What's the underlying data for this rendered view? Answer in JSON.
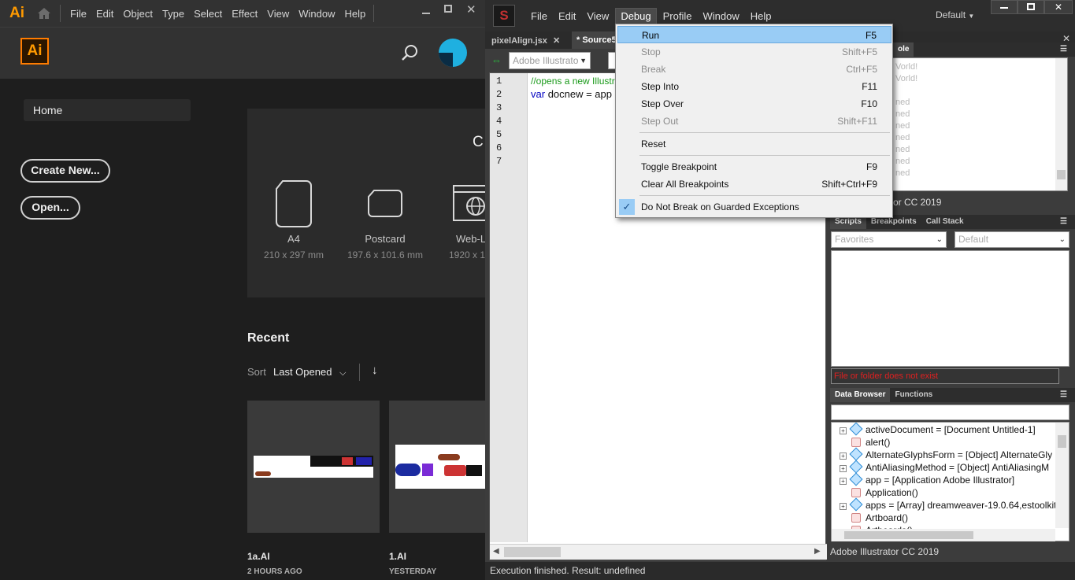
{
  "illustrator": {
    "logo_small": "Ai",
    "menu": [
      "File",
      "Edit",
      "Object",
      "Type",
      "Select",
      "Effect",
      "View",
      "Window",
      "Help"
    ],
    "logo": "Ai",
    "home": "Home",
    "create_new": "Create New...",
    "open": "Open...",
    "presets_heading_partial": "C",
    "presets": [
      {
        "name": "A4",
        "dims": "210 x 297 mm"
      },
      {
        "name": "Postcard",
        "dims": "197.6 x 101.6 mm"
      },
      {
        "name": "Web-L",
        "dims": "1920 x 1("
      }
    ],
    "recent": "Recent",
    "sort_label": "Sort",
    "sort_value": "Last Opened",
    "files": [
      {
        "name": "1a.AI",
        "time": "2 HOURS AGO"
      },
      {
        "name": "1.AI",
        "time": "YESTERDAY"
      }
    ]
  },
  "estk": {
    "menu": [
      "File",
      "Edit",
      "View",
      "Debug",
      "Profile",
      "Window",
      "Help"
    ],
    "workspace": "Default",
    "tabs": [
      "pixelAlign.jsx",
      "* Source5"
    ],
    "target_app": "Adobe Illustrato",
    "line_numbers": [
      "1",
      "2",
      "3",
      "4",
      "5",
      "6",
      "7"
    ],
    "code": [
      "//opens a new Illustra",
      "var docnew = app"
    ],
    "console_lines": [
      "Vorld!",
      "Vorld!",
      "",
      "ned",
      "ned",
      "ned",
      "ned",
      "ned",
      "ned",
      "ned"
    ],
    "console_tab_partial": "ole",
    "console_footer": "or CC 2019",
    "scripts_tabs": [
      "Scripts",
      "Breakpoints",
      "Call Stack"
    ],
    "favorites": "Favorites",
    "default_select": "Default",
    "file_error": "File or folder does not exist",
    "data_tabs": [
      "Data Browser",
      "Functions"
    ],
    "data_items": [
      {
        "kind": "obj",
        "text": "activeDocument = [Document Untitled-1]",
        "expand": true
      },
      {
        "kind": "fn",
        "text": "alert()",
        "expand": false
      },
      {
        "kind": "obj",
        "text": "AlternateGlyphsForm = [Object] AlternateGly",
        "expand": true
      },
      {
        "kind": "obj",
        "text": "AntiAliasingMethod = [Object] AntiAliasingM",
        "expand": true
      },
      {
        "kind": "obj",
        "text": "app = [Application Adobe Illustrator]",
        "expand": true
      },
      {
        "kind": "fn",
        "text": "Application()",
        "expand": false
      },
      {
        "kind": "obj",
        "text": "apps = [Array] dreamweaver-19.0.64,estoolkit",
        "expand": true
      },
      {
        "kind": "fn",
        "text": "Artboard()",
        "expand": false
      },
      {
        "kind": "fn",
        "text": "Artboards()",
        "expand": false
      }
    ],
    "data_footer": "Adobe Illustrator CC 2019",
    "status": "Execution finished. Result: undefined",
    "debug_menu": [
      {
        "label": "Run",
        "shortcut": "F5",
        "state": "highlight"
      },
      {
        "label": "Stop",
        "shortcut": "Shift+F5",
        "state": "disabled"
      },
      {
        "label": "Break",
        "shortcut": "Ctrl+F5",
        "state": "disabled"
      },
      {
        "label": "Step Into",
        "shortcut": "F11",
        "state": "enabled"
      },
      {
        "label": "Step Over",
        "shortcut": "F10",
        "state": "enabled"
      },
      {
        "label": "Step Out",
        "shortcut": "Shift+F11",
        "state": "disabled"
      },
      {
        "label": "Reset",
        "shortcut": "",
        "state": "enabled"
      },
      {
        "label": "Toggle Breakpoint",
        "shortcut": "F9",
        "state": "enabled"
      },
      {
        "label": "Clear All Breakpoints",
        "shortcut": "Shift+Ctrl+F9",
        "state": "enabled"
      },
      {
        "label": "Do Not Break on Guarded Exceptions",
        "shortcut": "",
        "state": "checked"
      }
    ]
  }
}
